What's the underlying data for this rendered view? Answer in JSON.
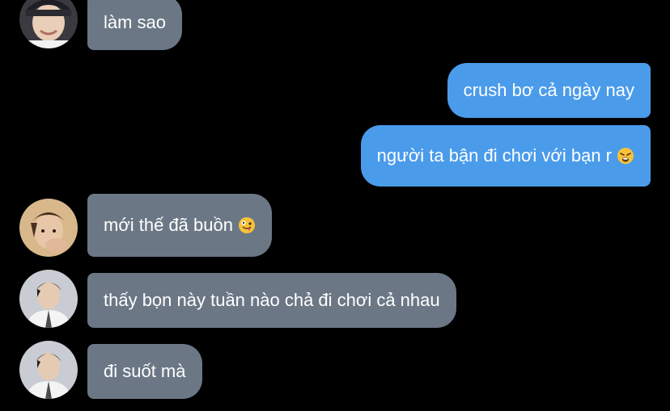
{
  "messages": [
    {
      "id": "m1",
      "direction": "incoming",
      "text": "làm sao",
      "emoji": null,
      "avatar": "avatar-dark-cap"
    },
    {
      "id": "m2",
      "direction": "outgoing",
      "text": "crush bơ cả ngày nay",
      "emoji": null
    },
    {
      "id": "m3",
      "direction": "outgoing",
      "text": "người ta bận đi chơi với bạn r",
      "emoji": "weary-face-emoji"
    },
    {
      "id": "m4",
      "direction": "incoming",
      "text": "mới thế đã buồn",
      "emoji": "zany-face-emoji",
      "avatar": "avatar-hand-face"
    },
    {
      "id": "m5",
      "direction": "incoming",
      "text": "thấy bọn này tuần nào chả đi chơi cả nhau",
      "emoji": null,
      "avatar": "avatar-white-shirt"
    },
    {
      "id": "m6",
      "direction": "incoming",
      "text": "đi suốt mà",
      "emoji": null,
      "avatar": "avatar-white-shirt"
    }
  ],
  "colors": {
    "background": "#000000",
    "incoming_bubble": "#6b7785",
    "outgoing_bubble": "#4a9bea",
    "text": "#ffffff"
  }
}
